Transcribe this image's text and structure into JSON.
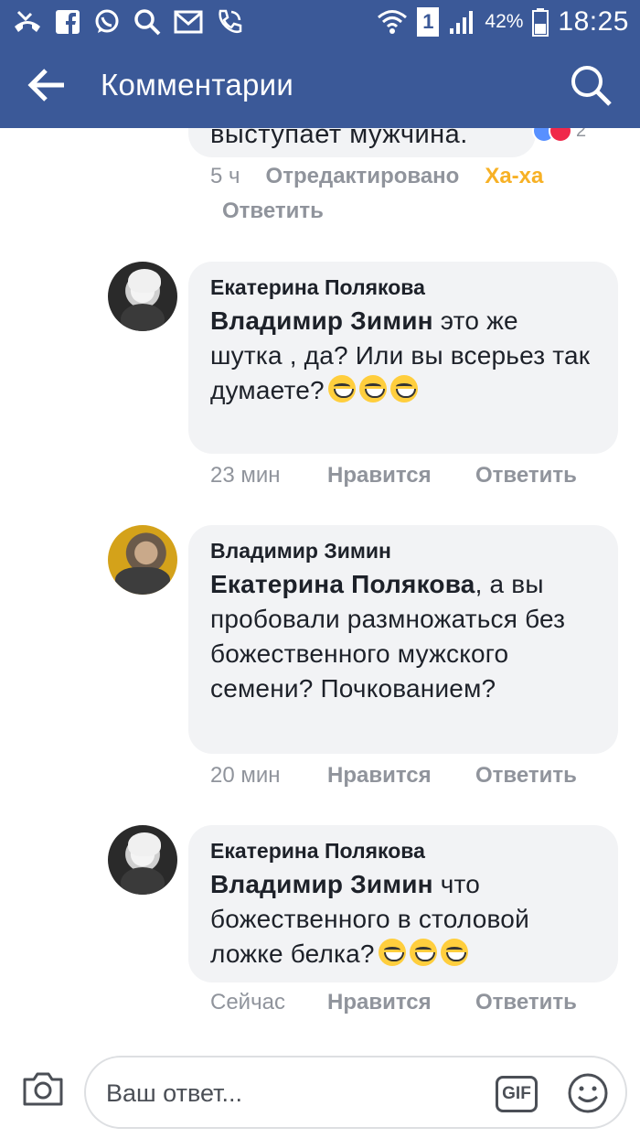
{
  "status_bar": {
    "battery_percent": "42%",
    "time": "18:25",
    "sim_label": "1"
  },
  "toolbar": {
    "title": "Комментарии"
  },
  "previous_comment": {
    "text_fragment": "выступает мужчина.",
    "reaction_count": "2",
    "time": "5 ч",
    "edited_label": "Отредактировано",
    "reaction_label": "Ха-ха",
    "reply_label": "Ответить"
  },
  "comments": [
    {
      "author": "Екатерина Полякова",
      "mention": "Владимир Зимин",
      "text": " это же шутка , да? Или вы всерьез так думаете?",
      "time": "23 мин",
      "like_label": "Нравится",
      "reply_label": "Ответить"
    },
    {
      "author": "Владимир Зимин",
      "mention": "Екатерина Полякова",
      "text": ", а вы пробовали размножаться без божественного мужского семени? Почкованием?",
      "time": "20 мин",
      "like_label": "Нравится",
      "reply_label": "Ответить"
    },
    {
      "author": "Екатерина Полякова",
      "mention": "Владимир Зимин",
      "text": " что божественного в столовой ложке белка?",
      "time": "Сейчас",
      "like_label": "Нравится",
      "reply_label": "Ответить"
    }
  ],
  "composer": {
    "placeholder": "Ваш ответ...",
    "gif_label": "GIF"
  }
}
